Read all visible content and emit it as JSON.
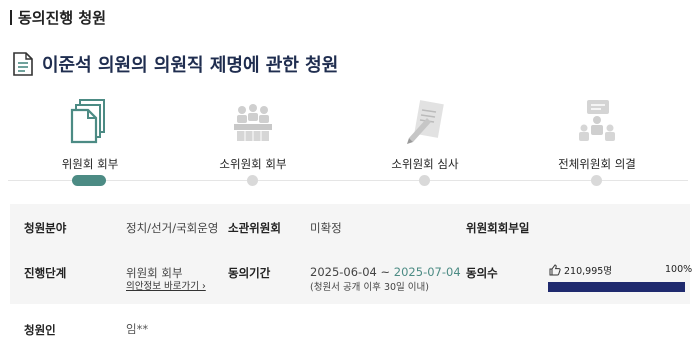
{
  "header": {
    "title": "동의진행 청원"
  },
  "petition": {
    "title": "이준석 의원의 의원직 제명에 관한 청원"
  },
  "steps": [
    {
      "label": "위원회 회부",
      "active": true,
      "icon": "documents-icon"
    },
    {
      "label": "소위원회 회부",
      "active": false,
      "icon": "conference-table-icon"
    },
    {
      "label": "소위원회 심사",
      "active": false,
      "icon": "review-pen-icon"
    },
    {
      "label": "전체위원회 의결",
      "active": false,
      "icon": "presentation-icon"
    }
  ],
  "info": {
    "field_label": "청원분야",
    "field_value": "정치/선거/국회운영",
    "committee_label": "소관위원회",
    "committee_value": "미확정",
    "referral_date_label": "위원회회부일",
    "status_label": "진행단계",
    "status_value": "위원회 회부",
    "status_link": "의안정보 바로가기 ›",
    "period_label": "동의기간",
    "period_start": "2025-06-04",
    "period_sep": "~",
    "period_end": "2025-07-04",
    "period_note": "(청원서 공개 이후 30일 이내)",
    "agree_label": "동의수",
    "agree_count": "210,995명",
    "agree_percent": "100%",
    "agree_progress": 1.0,
    "petitioner_label": "청원인",
    "petitioner_value": "임**"
  },
  "colors": {
    "accent": "#4c8b84",
    "progress": "#1f2a6e",
    "title": "#1f2d4f"
  }
}
